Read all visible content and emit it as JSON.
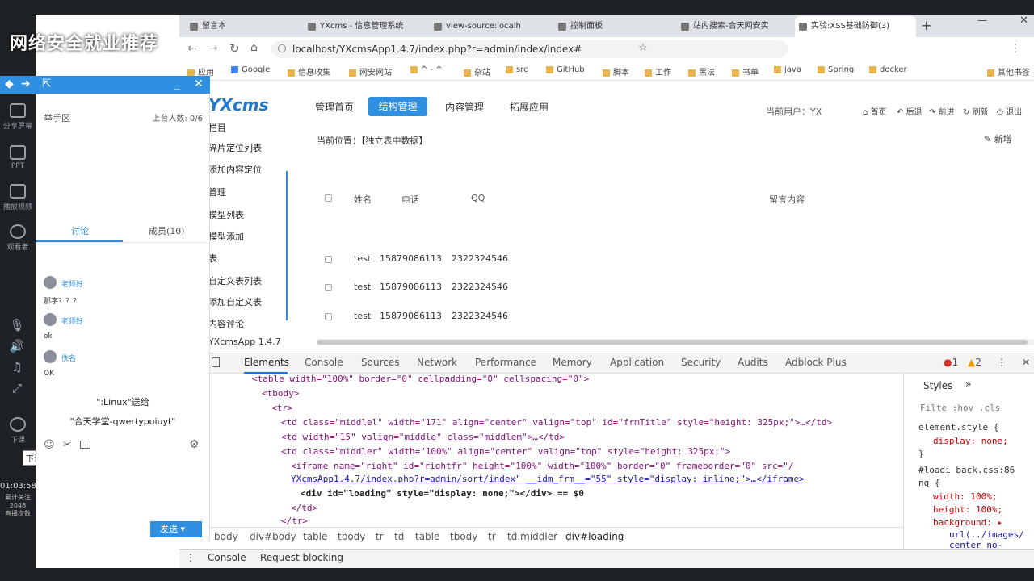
{
  "overlay": {
    "title": "网络安全就业推荐"
  },
  "left_sidebar": {
    "items": [
      {
        "label": "分享屏幕"
      },
      {
        "label": "PPT"
      },
      {
        "label": "播放视频"
      },
      {
        "label": "观看者"
      }
    ],
    "end_class_label": "下课",
    "tooltip": "下课",
    "clock": "01:03:58",
    "stats": "累计关注\n2048\n直播次数"
  },
  "chat": {
    "area_label": "举手区",
    "online": "上台人数: 0/6",
    "tabs": [
      "讨论",
      "成员(10)"
    ],
    "messages": [
      {
        "name": "老师好",
        "text": "那字？？？"
      },
      {
        "name": "老师好",
        "text": "ok"
      },
      {
        "name": "佚名",
        "text": "OK"
      }
    ],
    "gift_line": "\":Linux\"送给",
    "gift_user": "\"合天学堂-qwertypoiuyt\"",
    "send_label": "发送"
  },
  "browser": {
    "tabs": [
      {
        "title": "留言本"
      },
      {
        "title": "YXcms - 信息管理系统"
      },
      {
        "title": "view-source:localh"
      },
      {
        "title": "控制面板"
      },
      {
        "title": "站内搜索-合天网安实"
      },
      {
        "title": "实验:XSS基础防御(3)"
      }
    ],
    "url": "localhost/YXcmsApp1.4.7/index.php?r=admin/index/index#",
    "bookmarks": [
      "应用",
      "Google",
      "信息收集",
      "网安网站",
      "^ - ^",
      "杂站",
      "src",
      "GitHub",
      "脚本",
      "工作",
      "黑法",
      "书单",
      "java",
      "Spring",
      "docker",
      "其他书签"
    ]
  },
  "cms": {
    "logo": "YXcms",
    "nav": [
      "管理首页",
      "结构管理",
      "内容管理",
      "拓展应用"
    ],
    "current_user": "当前用户：YX",
    "header_links": [
      "首页",
      "后退",
      "前进",
      "刷新",
      "退出"
    ],
    "sidenav": [
      "栏目",
      "碎片定位列表",
      "添加内容定位",
      "管理",
      "模型列表",
      "模型添加",
      "表",
      "自定义表列表",
      "添加自定义表",
      "内容评论"
    ],
    "version": "YXcmsApp 1.4.7",
    "breadcrumb": "当前位置：【独立表中数据】",
    "new_button": "新增",
    "table": {
      "headers": [
        "姓名",
        "电话",
        "QQ",
        "留言内容"
      ],
      "rows": [
        {
          "name": "test",
          "phone": "15879086113",
          "qq": "2322324546"
        },
        {
          "name": "test",
          "phone": "15879086113",
          "qq": "2322324546"
        },
        {
          "name": "test",
          "phone": "15879086113",
          "qq": "2322324546"
        }
      ]
    }
  },
  "devtools": {
    "tabs": [
      "Elements",
      "Console",
      "Sources",
      "Network",
      "Performance",
      "Memory",
      "Application",
      "Security",
      "Audits",
      "Adblock Plus"
    ],
    "errors": "1",
    "warnings": "2",
    "dom_lines": [
      "<table width=\"100%\" border=\"0\" cellpadding=\"0\" cellspacing=\"0\">",
      "<tbody>",
      "<tr>",
      "<td class=\"middlel\" width=\"171\" align=\"center\" valign=\"top\" id=\"frmTitle\" style=\"height: 325px;\">…</td>",
      "<td width=\"15\" valign=\"middle\" class=\"middlem\">…</td>",
      "<td class=\"middler\" width=\"100%\" align=\"center\" valign=\"top\" style=\"height: 325px;\">",
      "<iframe name=\"right\" id=\"rightfr\" height=\"100%\" width=\"100%\" border=\"0\" frameborder=\"0\" src=\"/",
      "YXcmsApp1.4.7/index.php?r=admin/sort/index\" __idm_frm__=\"55\" style=\"display: inline;\">…</iframe>",
      "<div id=\"loading\" style=\"display: none;\"></div> == $0",
      "</td>",
      "</tr>"
    ],
    "styles_tab": "Styles",
    "styles_lines": [
      "Filte :hov .cls",
      "element.style {",
      "display: none;",
      "}",
      "#loadi    back.css:86",
      "ng {",
      "width: 100%;",
      "height: 100%;",
      "background: ▸",
      "url(../images/",
      "center no-"
    ],
    "breadcrumbs": [
      "body",
      "div#body",
      "table",
      "tbody",
      "tr",
      "td",
      "table",
      "tbody",
      "tr",
      "td.middler",
      "div#loading"
    ],
    "drawer_tabs": [
      "Console",
      "Request blocking"
    ]
  }
}
